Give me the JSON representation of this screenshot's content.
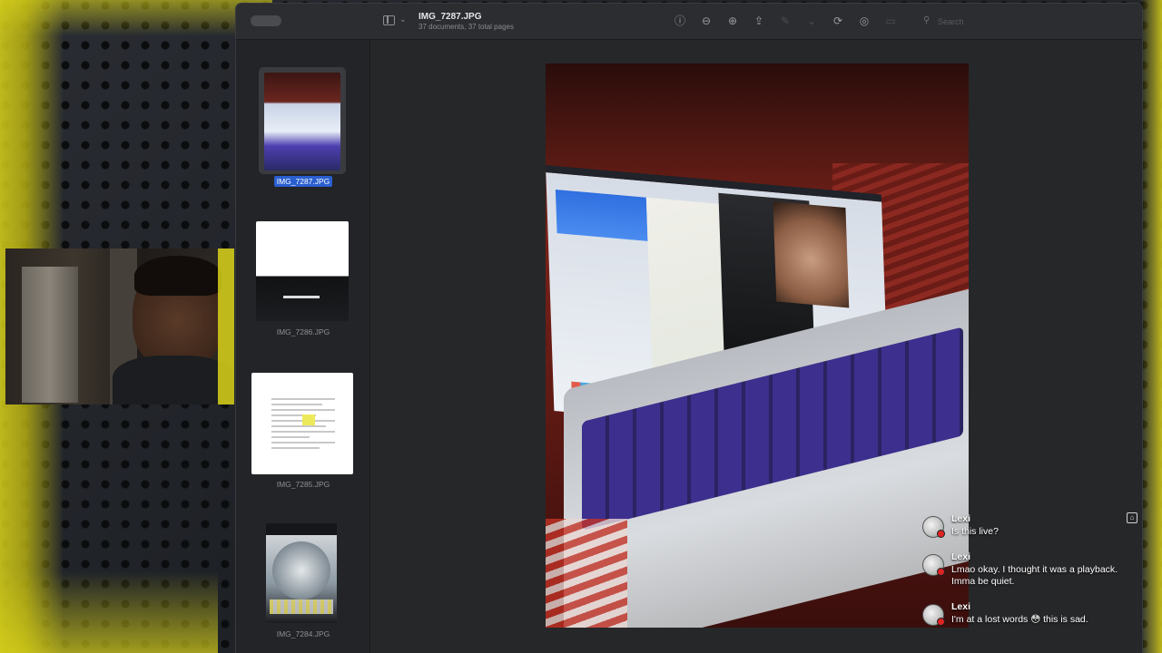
{
  "window": {
    "title": "IMG_7287.JPG",
    "subtitle": "37 documents, 37 total pages",
    "search_placeholder": "Search"
  },
  "toolbar": {
    "icons": [
      "info-icon",
      "zoom-out-icon",
      "zoom-in-icon",
      "share-icon",
      "markup-icon",
      "rotate-icon",
      "highlight-icon",
      "form-icon",
      "search-icon"
    ]
  },
  "thumbnails": [
    {
      "label": "IMG_7287.JPG",
      "selected": true
    },
    {
      "label": "IMG_7286.JPG",
      "selected": false
    },
    {
      "label": "IMG_7285.JPG",
      "selected": false
    },
    {
      "label": "IMG_7284.JPG",
      "selected": false
    }
  ],
  "chat": {
    "messages": [
      {
        "user": "Lexi",
        "text": "Is this live?"
      },
      {
        "user": "Lexi",
        "text": "Lmao okay. I thought it was a playback. Imma be quiet."
      },
      {
        "user": "Lexi",
        "text": "I'm at a lost words 😳 this is sad."
      }
    ]
  },
  "colors": {
    "accent_yellow": "#d9d21a",
    "selection_blue": "#2a5fd0",
    "live_red": "#e02424"
  }
}
